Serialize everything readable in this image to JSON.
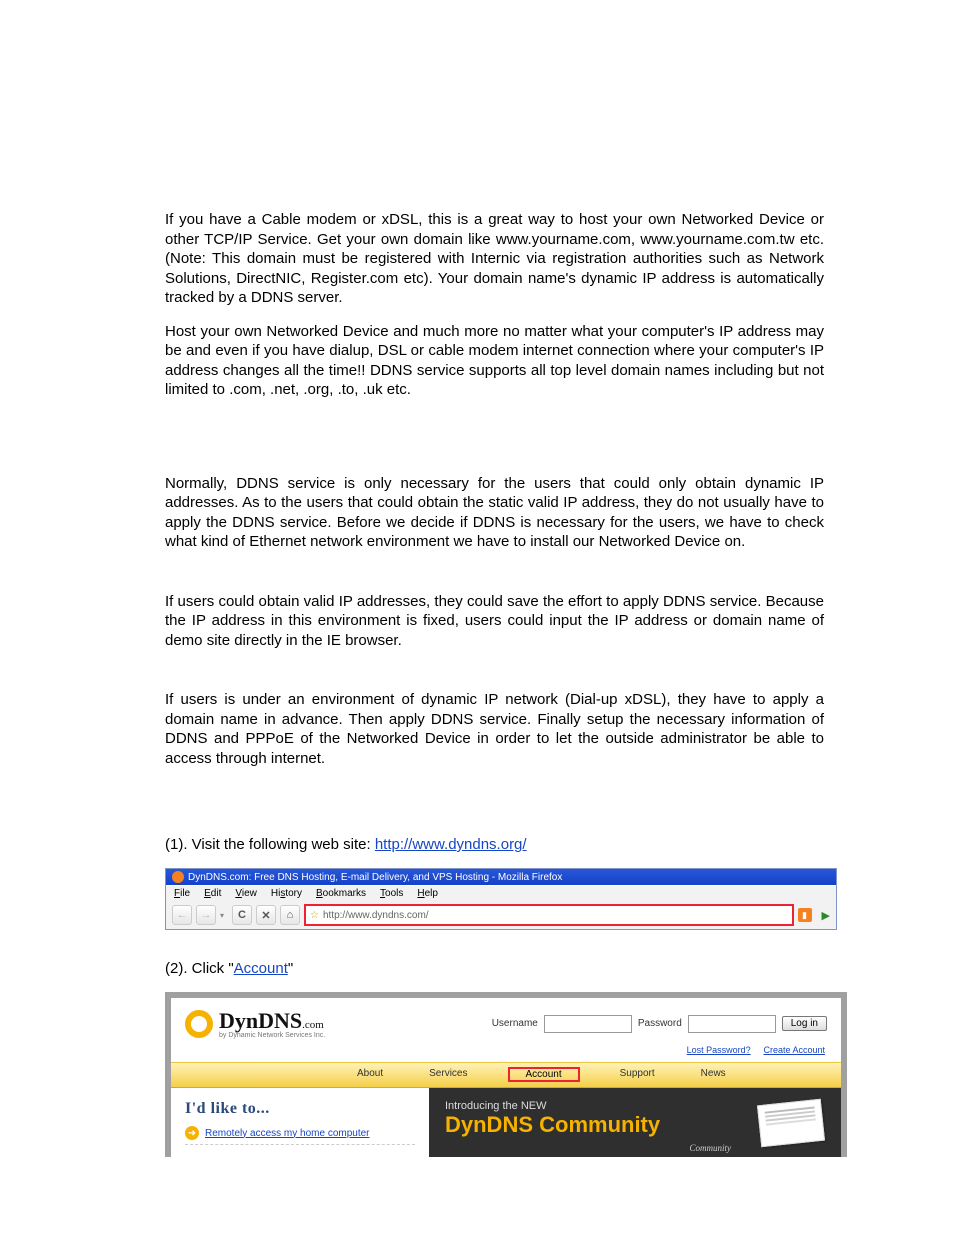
{
  "paragraphs": {
    "p1": "If you have a Cable modem or xDSL, this is a great way to host your own Networked Device or other TCP/IP Service. Get your own domain like www.yourname.com, www.yourname.com.tw etc. (Note: This domain must be registered with Internic via registration authorities such as Network Solutions, DirectNIC, Register.com etc). Your domain name's dynamic IP address is automatically tracked by a DDNS server.",
    "p2": "Host your own Networked Device and much more no matter what your computer's IP address may be and even if you have dialup, DSL or cable modem internet connection where your computer's IP address changes all the time!! DDNS service supports all top level domain names including but not limited to .com, .net, .org, .to, .uk etc.",
    "p3": "Normally, DDNS service is only necessary for the users that could only obtain dynamic IP addresses. As to the users that could obtain the static valid IP address, they do not usually have to apply the DDNS service. Before we decide if DDNS is necessary for the users, we have to check what kind of Ethernet network environment we have to install our Networked Device on.",
    "p4": "If users could obtain valid IP addresses, they could save the effort to apply DDNS service. Because the IP address in this environment is fixed, users could input the IP address or domain name of demo site directly in the IE browser.",
    "p5": "If users is under an environment of dynamic IP network (Dial-up xDSL), they have to apply a domain name in advance. Then apply DDNS service. Finally setup the necessary information of DDNS and PPPoE of the Networked Device in order to let the outside administrator be able to access through internet."
  },
  "steps": {
    "s1_pre": "(1). Visit the following web site: ",
    "s1_link": "http://www.dyndns.org/",
    "s2_pre": "(2). Click \"",
    "s2_link": "Account",
    "s2_post": "\""
  },
  "firefox": {
    "title": "DynDNS.com: Free DNS Hosting, E-mail Delivery, and VPS Hosting - Mozilla Firefox",
    "menu": {
      "file": "File",
      "edit": "Edit",
      "view": "View",
      "history": "History",
      "bookmarks": "Bookmarks",
      "tools": "Tools",
      "help": "Help"
    },
    "url": "http://www.dyndns.com/"
  },
  "dyndns": {
    "logo_main": "DynDNS",
    "logo_suffix": ".com",
    "logo_sub": "by Dynamic Network Services Inc.",
    "username": "Username",
    "password": "Password",
    "login": "Log in",
    "lost": "Lost Password?",
    "create": "Create Account",
    "nav": {
      "about": "About",
      "services": "Services",
      "account": "Account",
      "support": "Support",
      "news": "News"
    },
    "left_heading": "I'd like to...",
    "left_link": "Remotely access my home computer",
    "right_intro": "Introducing the NEW",
    "right_big": "DynDNS Community",
    "scribble": "Community"
  }
}
